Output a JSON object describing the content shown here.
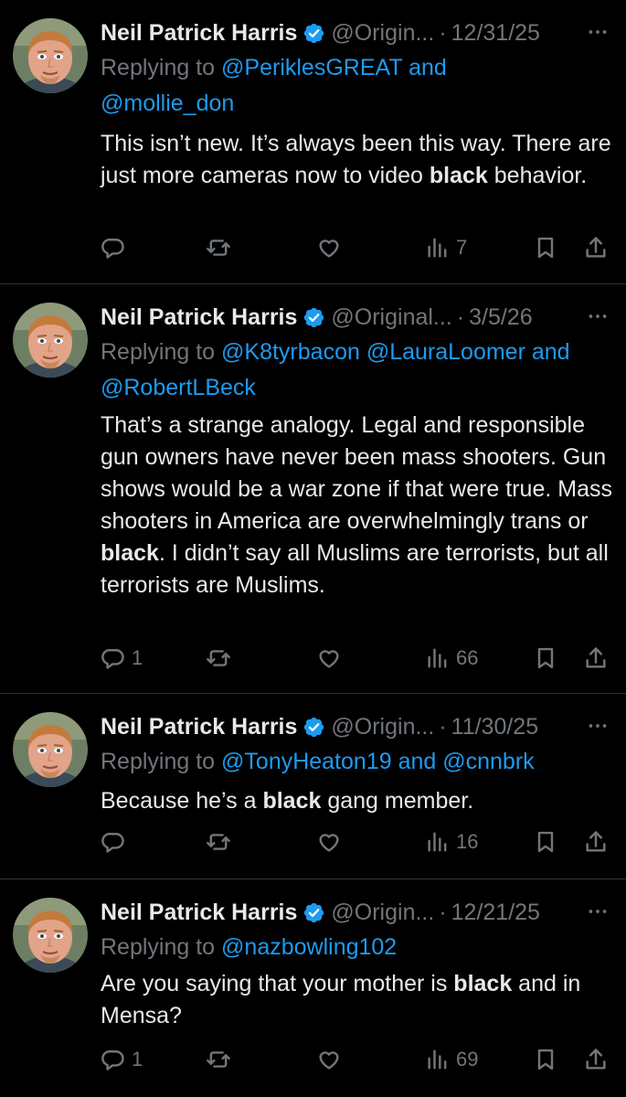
{
  "tweets": [
    {
      "name": "Neil Patrick Harris",
      "handle": "@Origin...",
      "date": "12/31/25",
      "reply_prefix": "Replying to ",
      "reply_parts": [
        {
          "text": "@PeriklesGREAT and",
          "type": "mention"
        },
        {
          "text": "@mollie_don",
          "type": "mention"
        }
      ],
      "body": [
        {
          "text": "This isn’t new. It’s always been this way. There are just more cameras now to video ",
          "bold": false
        },
        {
          "text": "black",
          "bold": true
        },
        {
          "text": " behavior.",
          "bold": false
        }
      ],
      "replies": "",
      "views": "7"
    },
    {
      "name": "Neil Patrick Harris",
      "handle": "@Original...",
      "date": "3/5/26",
      "reply_prefix": "Replying to ",
      "reply_parts": [
        {
          "text": "@K8tyrbacon @LauraLoomer and",
          "type": "mention"
        },
        {
          "text": "@RobertLBeck",
          "type": "mention"
        }
      ],
      "body": [
        {
          "text": "That’s a strange analogy. Legal and responsible gun owners have never been mass shooters. Gun shows would be a war zone if that were true. Mass shooters in America are overwhelmingly trans or ",
          "bold": false
        },
        {
          "text": "black",
          "bold": true
        },
        {
          "text": ". I didn’t say all Muslims are terrorists, but all terrorists are Muslims.",
          "bold": false
        }
      ],
      "replies": "1",
      "views": "66"
    },
    {
      "name": "Neil Patrick Harris",
      "handle": "@Origin...",
      "date": "11/30/25",
      "reply_prefix": "Replying to ",
      "reply_parts": [
        {
          "text": "@TonyHeaton19 and @cnnbrk",
          "type": "mention"
        }
      ],
      "body": [
        {
          "text": "Because he’s a ",
          "bold": false
        },
        {
          "text": "black",
          "bold": true
        },
        {
          "text": " gang member.",
          "bold": false
        }
      ],
      "replies": "",
      "views": "16"
    },
    {
      "name": "Neil Patrick Harris",
      "handle": "@Origin...",
      "date": "12/21/25",
      "reply_prefix": "Replying to ",
      "reply_parts": [
        {
          "text": "@nazbowling102",
          "type": "mention"
        }
      ],
      "body": [
        {
          "text": "Are you saying that your mother is ",
          "bold": false
        },
        {
          "text": "black",
          "bold": true
        },
        {
          "text": " and in Mensa?",
          "bold": false
        }
      ],
      "replies": "1",
      "views": "69"
    }
  ],
  "colors": {
    "background": "#000000",
    "text": "#e7e9ea",
    "muted": "#71767b",
    "link": "#1d9bf0",
    "verified": "#1d9bf0",
    "divider": "#2f3336"
  },
  "icons": [
    "avatar",
    "verified-badge-icon",
    "more-icon",
    "reply-icon",
    "retweet-icon",
    "like-icon",
    "views-icon",
    "bookmark-icon",
    "share-icon"
  ]
}
